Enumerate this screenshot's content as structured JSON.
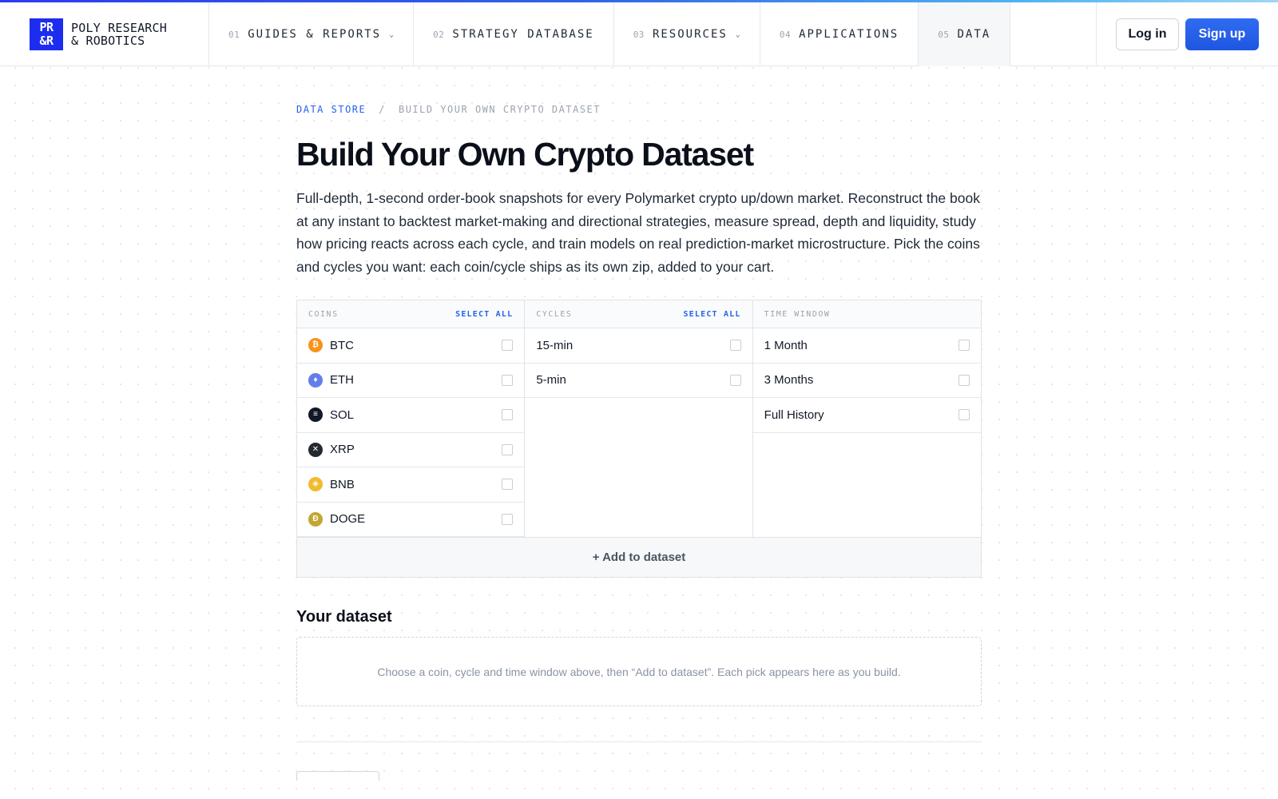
{
  "brand": {
    "logo_line1": "PR",
    "logo_line2": "&R",
    "name_line1": "POLY RESEARCH",
    "name_line2": "& ROBOTICS"
  },
  "nav": [
    {
      "num": "01",
      "label": "GUIDES & REPORTS",
      "dropdown": true
    },
    {
      "num": "02",
      "label": "STRATEGY DATABASE",
      "dropdown": false
    },
    {
      "num": "03",
      "label": "RESOURCES",
      "dropdown": true
    },
    {
      "num": "04",
      "label": "APPLICATIONS",
      "dropdown": false
    },
    {
      "num": "05",
      "label": "DATA",
      "dropdown": false,
      "active": true
    }
  ],
  "auth": {
    "login": "Log in",
    "signup": "Sign up"
  },
  "breadcrumb": {
    "parent": "DATA STORE",
    "separator": "/",
    "current": "BUILD YOUR OWN CRYPTO DATASET"
  },
  "page": {
    "title": "Build Your Own Crypto Dataset",
    "description": "Full-depth, 1-second order-book snapshots for every Polymarket crypto up/down market. Reconstruct the book at any instant to backtest market-making and directional strategies, measure spread, depth and liquidity, study how pricing reacts across each cycle, and train models on real prediction-market microstructure. Pick the coins and cycles you want: each coin/cycle ships as its own zip, added to your cart."
  },
  "selector": {
    "coins": {
      "header": "COINS",
      "select_all": "SELECT ALL",
      "items": [
        {
          "label": "BTC",
          "icon": "bitcoin-icon",
          "glyph": "₿",
          "color": "#f7931a"
        },
        {
          "label": "ETH",
          "icon": "ethereum-icon",
          "glyph": "♦",
          "color": "#627eea"
        },
        {
          "label": "SOL",
          "icon": "solana-icon",
          "glyph": "≡",
          "color": "#111827"
        },
        {
          "label": "XRP",
          "icon": "xrp-icon",
          "glyph": "✕",
          "color": "#23292f"
        },
        {
          "label": "BNB",
          "icon": "bnb-icon",
          "glyph": "◈",
          "color": "#f3ba2f"
        },
        {
          "label": "DOGE",
          "icon": "doge-icon",
          "glyph": "Ð",
          "color": "#c2a633"
        }
      ]
    },
    "cycles": {
      "header": "CYCLES",
      "select_all": "SELECT ALL",
      "items": [
        {
          "label": "15-min"
        },
        {
          "label": "5-min"
        }
      ]
    },
    "time_window": {
      "header": "TIME WINDOW",
      "items": [
        {
          "label": "1 Month"
        },
        {
          "label": "3 Months"
        },
        {
          "label": "Full History"
        }
      ]
    },
    "add_button": "+ Add to dataset"
  },
  "dataset": {
    "title": "Your dataset",
    "empty_text": "Choose a coin, cycle and time window above, then “Add to dataset”. Each pick appears here as you build."
  }
}
